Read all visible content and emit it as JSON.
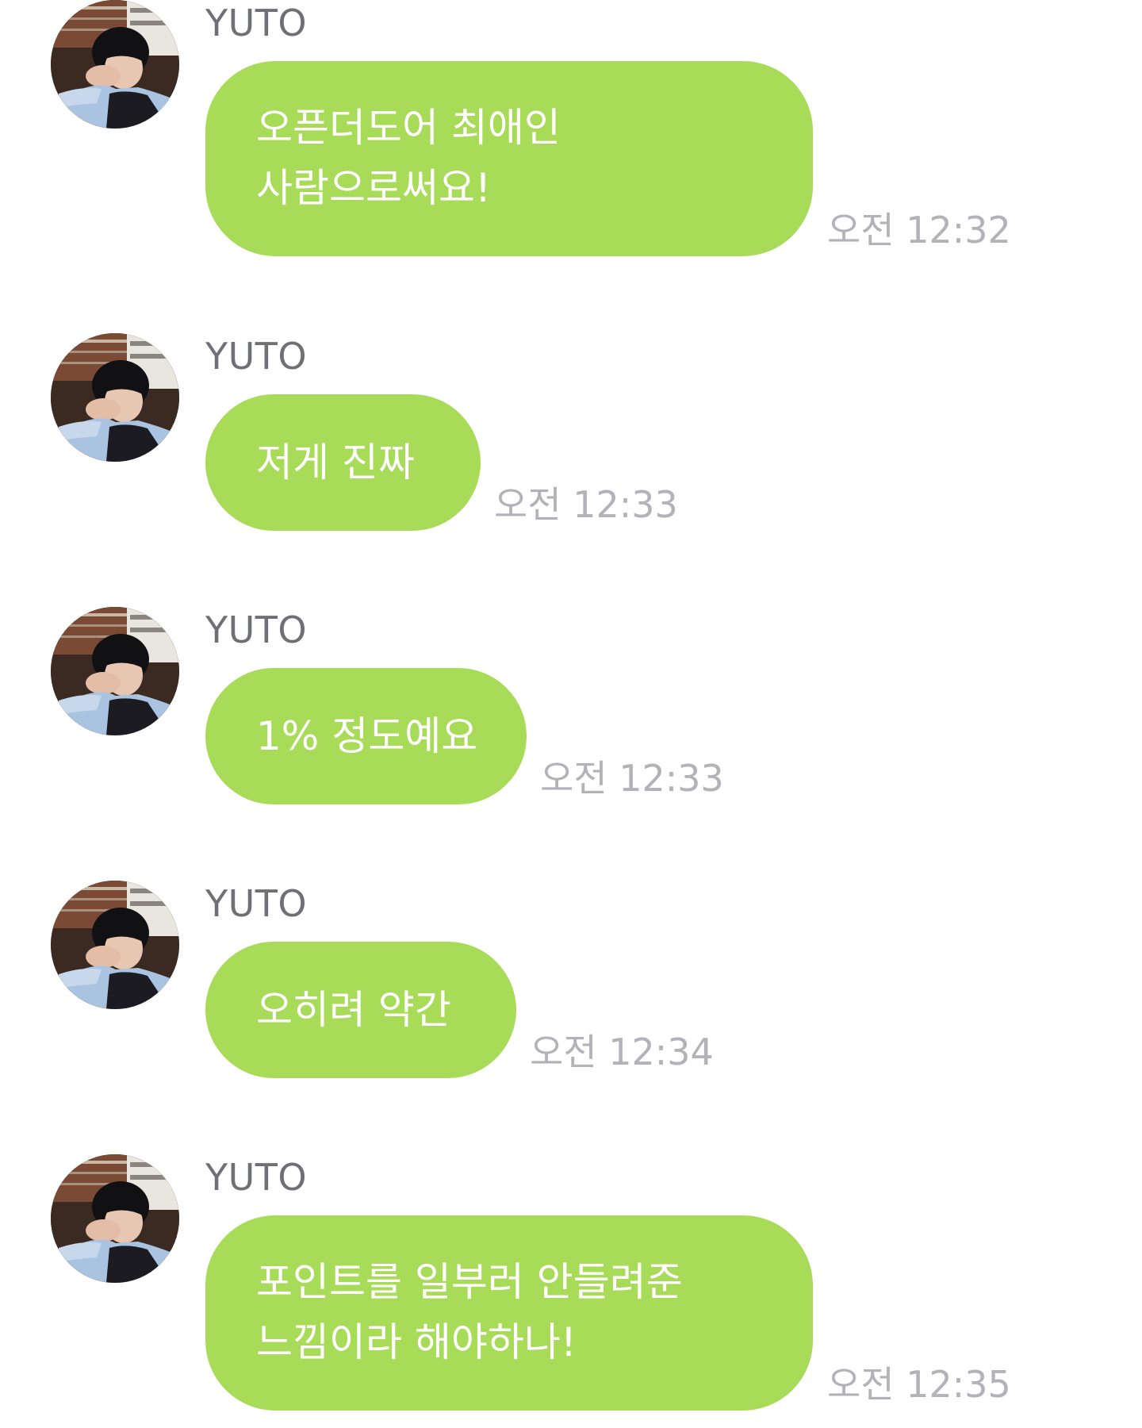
{
  "colors": {
    "background": "#ffffff",
    "bubble": "#a8db57",
    "bubble_text": "#ffffff",
    "sender_name": "#6f6f76",
    "timestamp": "#b2b2b8"
  },
  "messages": [
    {
      "sender": "YUTO",
      "avatar_icon": "profile-photo",
      "lines": [
        "오픈더도어 최애인",
        "사람으로써요!"
      ],
      "time": "오전 12:32"
    },
    {
      "sender": "YUTO",
      "avatar_icon": "profile-photo",
      "lines": [
        "저게 진짜"
      ],
      "time": "오전 12:33"
    },
    {
      "sender": "YUTO",
      "avatar_icon": "profile-photo",
      "lines": [
        "1% 정도예요"
      ],
      "time": "오전 12:33"
    },
    {
      "sender": "YUTO",
      "avatar_icon": "profile-photo",
      "lines": [
        "오히려 약간"
      ],
      "time": "오전 12:34"
    },
    {
      "sender": "YUTO",
      "avatar_icon": "profile-photo",
      "lines": [
        "포인트를 일부러 안들려준",
        "느낌이라 해야하나!"
      ],
      "time": "오전 12:35"
    }
  ]
}
